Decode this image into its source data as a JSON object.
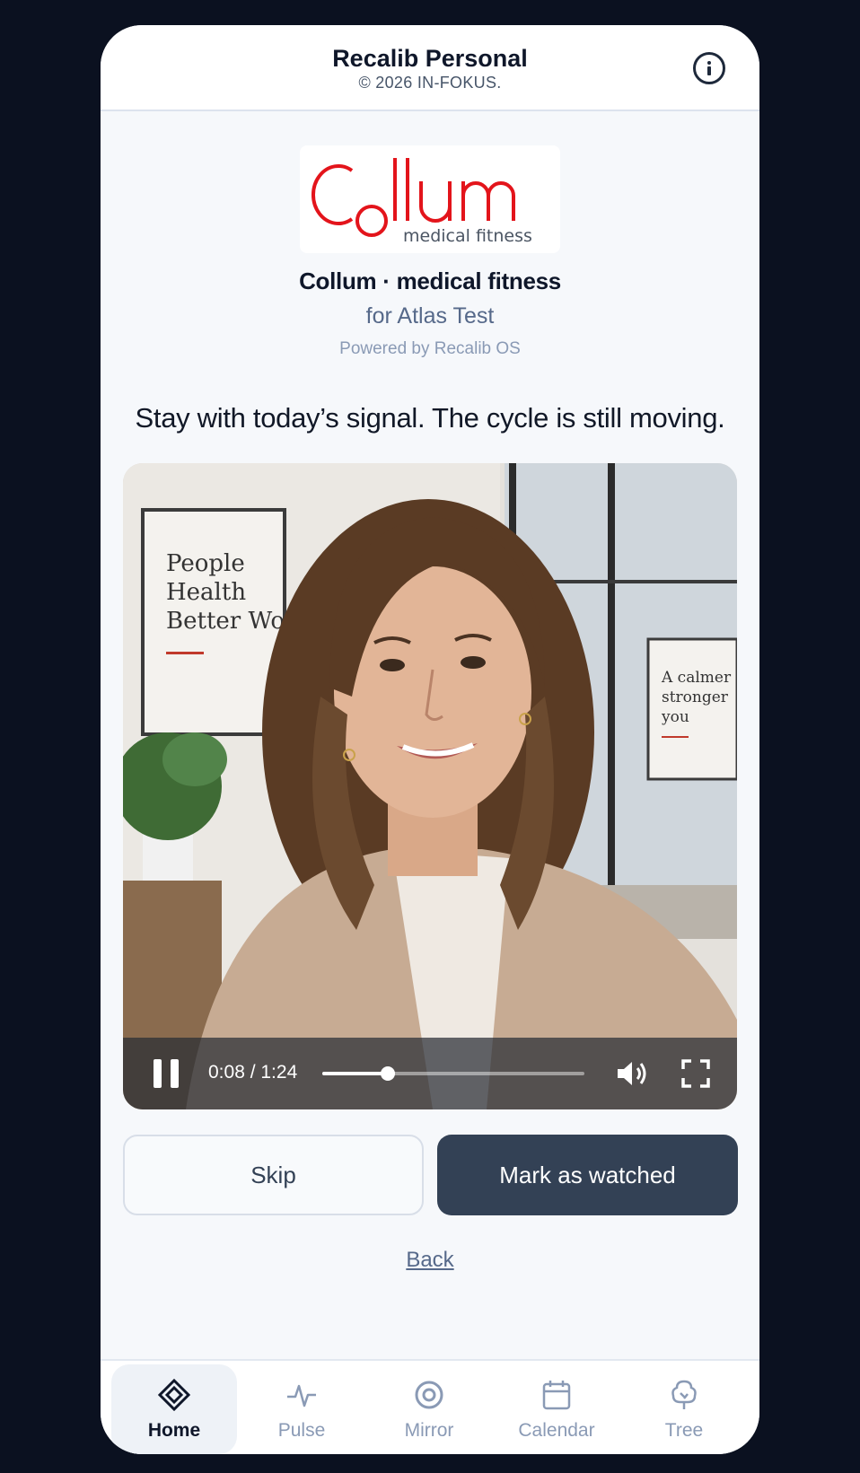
{
  "header": {
    "title": "Recalib Personal",
    "copyright": "© 2026 IN-FOKUS.",
    "info_icon": "info-icon"
  },
  "logo": {
    "wordmark": "Collum",
    "subtitle": "medical fitness",
    "color": "#e3141b"
  },
  "brand": {
    "name": "Collum · medical fitness",
    "for_line": "for Atlas Test",
    "powered_by": "Powered by Recalib OS"
  },
  "tagline": "Stay with today’s signal. The cycle is still moving.",
  "video": {
    "poster_left": [
      "People",
      "Health",
      "Better Work"
    ],
    "poster_right": [
      "A calmer",
      "stronger",
      "you"
    ],
    "time": "0:08 / 1:24",
    "progress": 0.25,
    "controls": [
      "pause-icon",
      "volume-icon",
      "fullscreen-icon"
    ]
  },
  "actions": {
    "skip_label": "Skip",
    "watched_label": "Mark as watched",
    "back_label": "Back"
  },
  "tabs": [
    {
      "label": "Home",
      "icon": "home-diamond-icon",
      "active": true
    },
    {
      "label": "Pulse",
      "icon": "pulse-icon",
      "active": false
    },
    {
      "label": "Mirror",
      "icon": "mirror-target-icon",
      "active": false
    },
    {
      "label": "Calendar",
      "icon": "calendar-icon",
      "active": false
    },
    {
      "label": "Tree",
      "icon": "tree-icon",
      "active": false
    }
  ],
  "colors": {
    "background": "#0b1120",
    "accent_dark": "#334155",
    "muted_text": "#56698a"
  }
}
